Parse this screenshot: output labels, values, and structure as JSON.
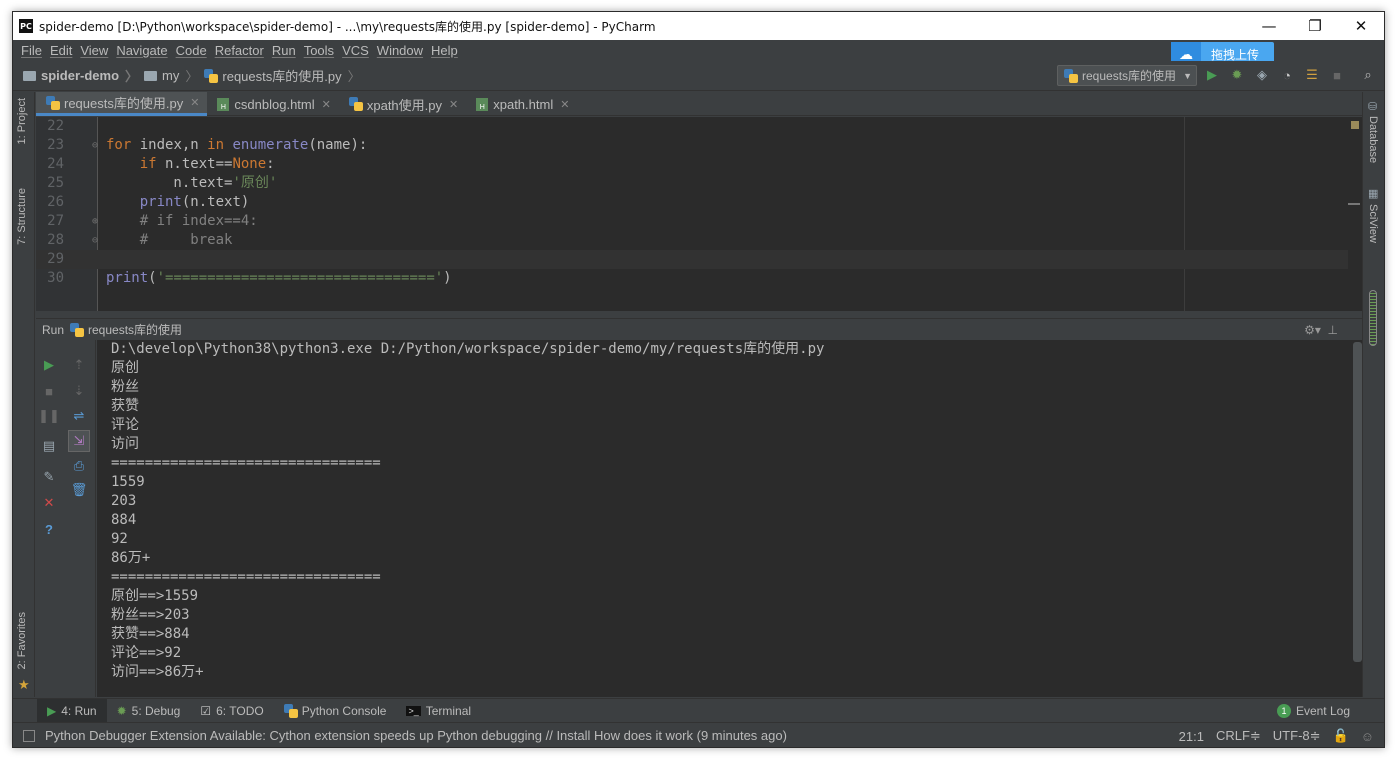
{
  "window": {
    "title": "spider-demo [D:\\Python\\workspace\\spider-demo] - ...\\my\\requests库的使用.py [spider-demo] - PyCharm",
    "app_icon": "PC",
    "minimize": "—",
    "maximize": "❐",
    "close": "✕"
  },
  "menu": [
    "File",
    "Edit",
    "View",
    "Navigate",
    "Code",
    "Refactor",
    "Run",
    "Tools",
    "VCS",
    "Window",
    "Help"
  ],
  "upload": {
    "label": "拖拽上传",
    "icon": "cloud-icon"
  },
  "breadcrumb": [
    "spider-demo",
    "my",
    "requests库的使用.py"
  ],
  "run_config": {
    "label": "requests库的使用"
  },
  "left_tabs": {
    "project": "1: Project",
    "structure": "7: Structure",
    "favorites": "2: Favorites"
  },
  "right_tabs": {
    "database": "Database",
    "sciview": "SciView"
  },
  "tabs": [
    {
      "label": "requests库的使用.py",
      "type": "py",
      "active": true
    },
    {
      "label": "csdnblog.html",
      "type": "html",
      "active": false
    },
    {
      "label": "xpath使用.py",
      "type": "py",
      "active": false
    },
    {
      "label": "xpath.html",
      "type": "html",
      "active": false
    }
  ],
  "code": {
    "lines": [
      {
        "n": "22",
        "html": ""
      },
      {
        "n": "23",
        "html": "<span class=\"kw\">for</span> index,n <span class=\"kw\">in</span> <span class=\"bi\">enumerate</span>(name):"
      },
      {
        "n": "24",
        "html": "    <span class=\"kw\">if</span> n.text==<span class=\"kw\">None</span>:"
      },
      {
        "n": "25",
        "html": "        n.text=<span class=\"str\">'原创'</span>"
      },
      {
        "n": "26",
        "html": "    <span class=\"bi\">print</span>(n.text)"
      },
      {
        "n": "27",
        "html": "    <span class=\"cm\"># if index==4:</span>"
      },
      {
        "n": "28",
        "html": "    <span class=\"cm\">#     break</span>"
      },
      {
        "n": "29",
        "html": ""
      },
      {
        "n": "30",
        "html": "<span class=\"bi\">print</span>(<span class=\"str\">'================================'</span>)"
      }
    ]
  },
  "run": {
    "header_label": "Run",
    "config": "requests库的使用",
    "output": [
      "D:\\develop\\Python38\\python3.exe D:/Python/workspace/spider-demo/my/requests库的使用.py",
      "原创",
      "粉丝",
      "获赞",
      "评论",
      "访问",
      "================================",
      "1559",
      "203",
      "884",
      "92",
      "86万+",
      "================================",
      "原创==>1559",
      "粉丝==>203",
      "获赞==>884",
      "评论==>92",
      "访问==>86万+"
    ]
  },
  "tool_windows": [
    {
      "label": "4: Run",
      "icon": "play-icon",
      "active": true
    },
    {
      "label": "5: Debug",
      "icon": "bug-icon",
      "active": false
    },
    {
      "label": "6: TODO",
      "icon": "todo-icon",
      "active": false
    },
    {
      "label": "Python Console",
      "icon": "python-icon",
      "active": false
    },
    {
      "label": "Terminal",
      "icon": "terminal-icon",
      "active": false
    }
  ],
  "event_log": {
    "label": "Event Log",
    "count": "1"
  },
  "status": {
    "message": "Python Debugger Extension Available: Cython extension speeds up Python debugging // Install How does it work (9 minutes ago)",
    "position": "21:1",
    "line_sep": "CRLF≑",
    "encoding": "UTF-8≑"
  },
  "colors": {
    "accent": "#4a88c7",
    "run_green": "#499c54",
    "editor_bg": "#2b2b2b",
    "ui_bg": "#3c3f41"
  }
}
